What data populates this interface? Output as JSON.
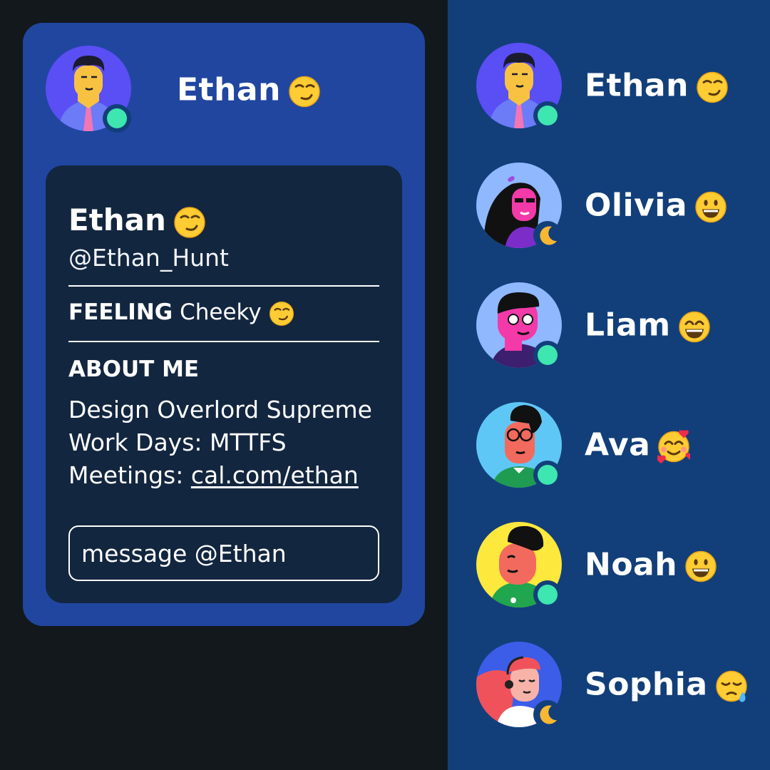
{
  "profile": {
    "header_name": "Ethan",
    "name": "Ethan",
    "handle": "@Ethan_Hunt",
    "feeling_label": "FEELING",
    "feeling_value": "Cheeky",
    "about_heading": "ABOUT ME",
    "about_line1": "Design Overlord Supreme",
    "about_line2": "Work Days: MTTFS",
    "about_line3_prefix": "Meetings: ",
    "about_link": "cal.com/ethan",
    "message_placeholder": "message @Ethan",
    "emoji": "smirking-face"
  },
  "users": [
    {
      "name": "Ethan",
      "emoji": "smirking-face",
      "status": "online"
    },
    {
      "name": "Olivia",
      "emoji": "grinning-face",
      "status": "away"
    },
    {
      "name": "Liam",
      "emoji": "grinning-face-with-smiling-eyes",
      "status": "online"
    },
    {
      "name": "Ava",
      "emoji": "smiling-face-with-hearts",
      "status": "online"
    },
    {
      "name": "Noah",
      "emoji": "grinning-face",
      "status": "online"
    },
    {
      "name": "Sophia",
      "emoji": "sleepy-face",
      "status": "away"
    }
  ],
  "colors": {
    "left_background": "#12181c",
    "right_background": "#123f7a",
    "popover_background": "#2146a0",
    "card_background": "#13263f",
    "online": "#3ee6b0",
    "away": "#f7b733"
  }
}
